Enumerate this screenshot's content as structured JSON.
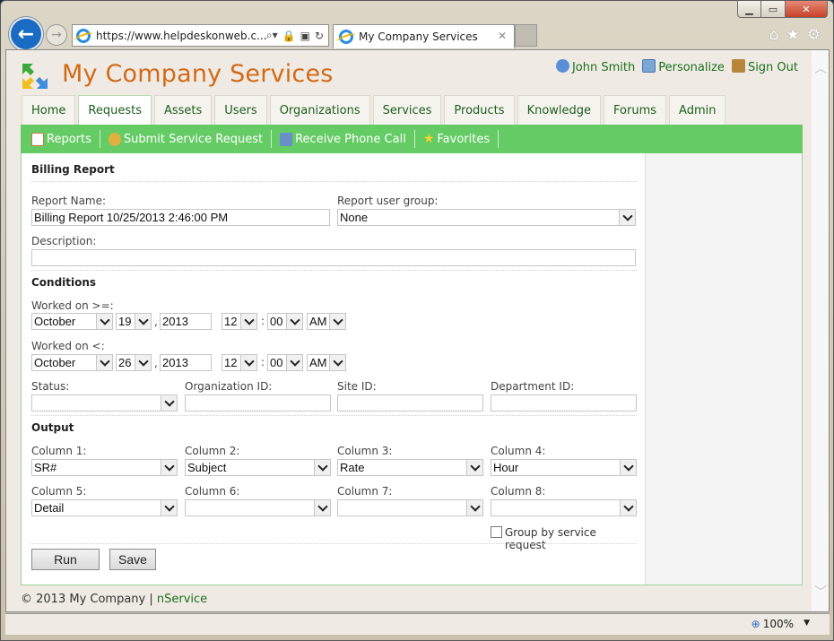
{
  "browser": {
    "url": "https://www.helpdeskonweb.c...",
    "tab_title": "My Company Services",
    "window_controls": {
      "minimize": "minimize-icon",
      "maximize": "maximize-icon",
      "close": "close-icon"
    },
    "zoom_level": "100%"
  },
  "header": {
    "app_title": "My Company Services",
    "user_links": [
      {
        "label": "John Smith",
        "icon": "user-icon"
      },
      {
        "label": "Personalize",
        "icon": "personalize-icon"
      },
      {
        "label": "Sign Out",
        "icon": "sign-out-icon"
      }
    ]
  },
  "nav": {
    "tabs": [
      "Home",
      "Requests",
      "Assets",
      "Users",
      "Organizations",
      "Services",
      "Products",
      "Knowledge",
      "Forums",
      "Admin"
    ],
    "active_tab": "Requests",
    "subnav": [
      {
        "label": "Reports",
        "icon": "reports-icon"
      },
      {
        "label": "Submit Service Request",
        "icon": "submit-request-icon"
      },
      {
        "label": "Receive Phone Call",
        "icon": "phone-icon"
      },
      {
        "label": "Favorites",
        "icon": "star-icon"
      }
    ]
  },
  "colors": {
    "accent_green": "#65cc65",
    "title_orange": "#d36a17",
    "link_green": "#1d6e1d"
  },
  "form": {
    "section_title": "Billing Report",
    "report_name_label": "Report Name:",
    "report_name_value": "Billing Report 10/25/2013 2:46:00 PM",
    "user_group_label": "Report user group:",
    "user_group_value": "None",
    "description_label": "Description:",
    "description_value": "",
    "conditions_title": "Conditions",
    "from": {
      "label": "Worked on >=:",
      "month": "October",
      "day": "19",
      "year": "2013",
      "hour": "12",
      "minute": "00",
      "ampm": "AM"
    },
    "to": {
      "label": "Worked on <:",
      "month": "October",
      "day": "26",
      "year": "2013",
      "hour": "12",
      "minute": "00",
      "ampm": "AM"
    },
    "comma": ",",
    "colon": ":",
    "status_label": "Status:",
    "status_value": "",
    "org_label": "Organization ID:",
    "site_label": "Site ID:",
    "dept_label": "Department ID:",
    "output_title": "Output",
    "columns": [
      {
        "label": "Column 1:",
        "value": "SR#"
      },
      {
        "label": "Column 2:",
        "value": "Subject"
      },
      {
        "label": "Column 3:",
        "value": "Rate"
      },
      {
        "label": "Column 4:",
        "value": "Hour"
      },
      {
        "label": "Column 5:",
        "value": "Detail"
      },
      {
        "label": "Column 6:",
        "value": ""
      },
      {
        "label": "Column 7:",
        "value": ""
      },
      {
        "label": "Column 8:",
        "value": ""
      }
    ],
    "group_by_label": "Group by service request",
    "group_by_checked": false,
    "run_label": "Run",
    "save_label": "Save"
  },
  "footer": {
    "copyright": "© 2013 My Company |",
    "link": "nService"
  }
}
